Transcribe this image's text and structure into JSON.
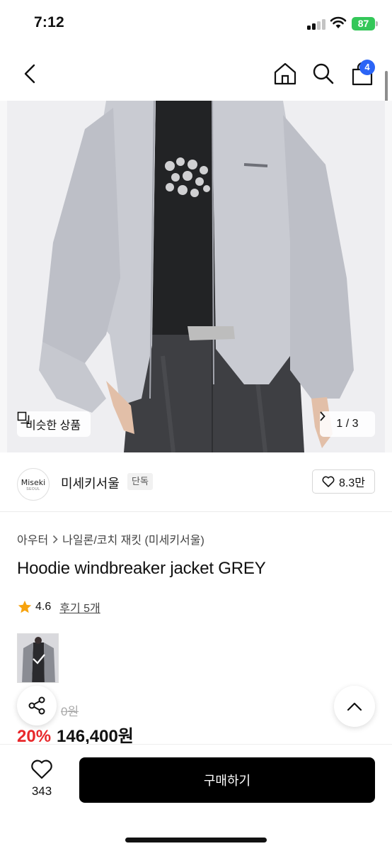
{
  "status_bar": {
    "time": "7:12",
    "battery": "87",
    "battery_color": "#34c759"
  },
  "nav": {
    "cart_count": "4",
    "badge_color": "#2b64f6"
  },
  "gallery": {
    "similar_label": "비슷한 상품",
    "counter": "1 / 3"
  },
  "brand": {
    "logo_text": "Miseki",
    "logo_sub": "SEOUL",
    "name": "미세키서울",
    "badge": "단독",
    "likes": "8.3만"
  },
  "breadcrumb": {
    "category": "아우터",
    "subcategory": "나일론/코치 재킷 (미세키서울)"
  },
  "product": {
    "title": "Hoodie windbreaker jacket GREY",
    "rating": "4.6",
    "reviews": "후기 5개",
    "original_price": "0원",
    "discount": "20%",
    "sale_price": "146,400원",
    "discount_color": "#e8282b"
  },
  "bottom_bar": {
    "wish_count": "343",
    "buy_label": "구매하기"
  }
}
